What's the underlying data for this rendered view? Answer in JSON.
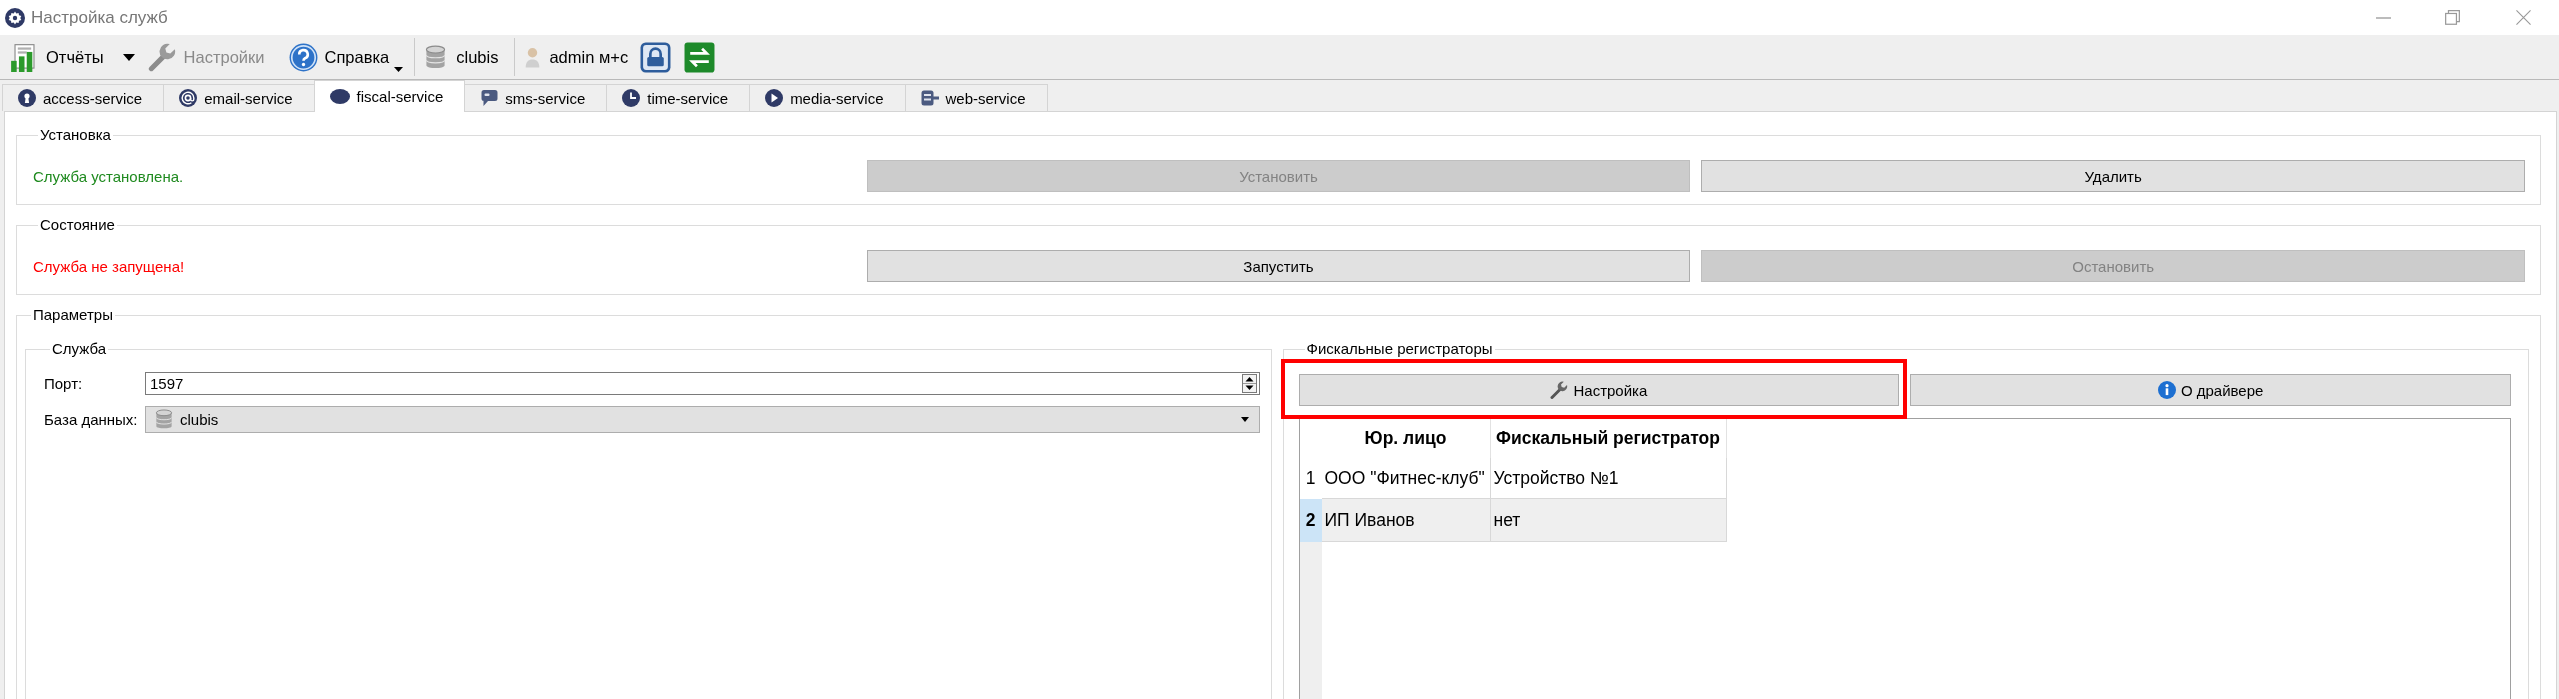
{
  "window": {
    "title": "Настройка служб"
  },
  "toolbar": {
    "buttons": [
      {
        "kind": "split",
        "label": "Отчёты",
        "disabled": false
      },
      {
        "kind": "plain",
        "label": "Настройки",
        "disabled": true
      },
      {
        "kind": "menu",
        "label": "Справка",
        "disabled": false
      }
    ],
    "database": {
      "label": "clubis"
    },
    "user": {
      "label": "admin м+с"
    }
  },
  "tabs": [
    {
      "label": "access-service",
      "selected": false
    },
    {
      "label": "email-service",
      "selected": false
    },
    {
      "label": "fiscal-service",
      "selected": true
    },
    {
      "label": "sms-service",
      "selected": false
    },
    {
      "label": "time-service",
      "selected": false
    },
    {
      "label": "media-service",
      "selected": false
    },
    {
      "label": "web-service",
      "selected": false
    }
  ],
  "sections": [
    {
      "title": "Установка",
      "status": {
        "text": "Служба установлена.",
        "kind": "ok"
      },
      "buttons": [
        {
          "label": "Установить",
          "disabled": true
        },
        {
          "label": "Удалить",
          "disabled": false
        }
      ]
    },
    {
      "title": "Состояние",
      "status": {
        "text": "Служба не запущена!",
        "kind": "error"
      },
      "buttons": [
        {
          "label": "Запустить",
          "disabled": false
        },
        {
          "label": "Остановить",
          "disabled": true
        }
      ]
    }
  ],
  "parameters": {
    "title": "Параметры",
    "service": {
      "title": "Служба",
      "port": {
        "label": "Порт:",
        "value": "1597"
      },
      "database": {
        "label": "База данных:",
        "value": "clubis"
      }
    },
    "fiscal_registers": {
      "title": "Фискальные регистраторы",
      "buttons": [
        {
          "label": "Настройка",
          "highlighted": true
        },
        {
          "label": "О драйвере",
          "highlighted": false
        }
      ],
      "table": {
        "columns": [
          "Юр. лицо",
          "Фискальный регистратор"
        ],
        "rows": [
          {
            "number": "1",
            "cells": [
              "ООО \"Фитнес-клуб\"",
              "Устройство №1"
            ],
            "selected": false
          },
          {
            "number": "2",
            "cells": [
              "ИП Иванов",
              "нет"
            ],
            "selected": true
          }
        ]
      }
    }
  }
}
